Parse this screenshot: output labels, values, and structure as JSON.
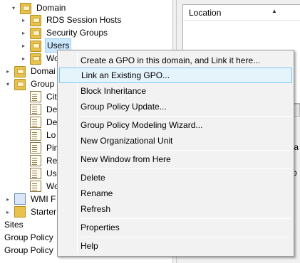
{
  "tree": {
    "items": [
      {
        "label": "Domain",
        "arrow": "▾",
        "icon": "folder-icon"
      },
      {
        "label": "RDS Session Hosts",
        "arrow": "▸",
        "icon": "folder-icon"
      },
      {
        "label": "Security Groups",
        "arrow": "▸",
        "icon": "folder-icon"
      },
      {
        "label": "Users",
        "arrow": "▸",
        "icon": "folder-icon",
        "selected": true
      },
      {
        "label": "Wo",
        "arrow": "▸",
        "icon": "folder-icon"
      },
      {
        "label": "Domai",
        "arrow": "▸",
        "icon": "folder-icon"
      },
      {
        "label": "Group",
        "arrow": "▾",
        "icon": "folder-icon"
      },
      {
        "label": "Cit",
        "icon": "gpo-document-icon"
      },
      {
        "label": "De",
        "icon": "gpo-document-icon"
      },
      {
        "label": "De",
        "icon": "gpo-document-icon"
      },
      {
        "label": "Lo",
        "icon": "gpo-document-icon"
      },
      {
        "label": "Pin",
        "icon": "gpo-document-icon"
      },
      {
        "label": "Re",
        "icon": "gpo-document-icon"
      },
      {
        "label": "Us",
        "icon": "gpo-document-icon"
      },
      {
        "label": "Wo",
        "icon": "gpo-document-icon"
      },
      {
        "label": "WMI F",
        "arrow": "▸",
        "icon": "wmi-filter-icon"
      },
      {
        "label": "Starter",
        "arrow": "▸",
        "icon": "starter-gpo-icon"
      },
      {
        "label": "Sites"
      },
      {
        "label": "Group Policy"
      },
      {
        "label": "Group Policy"
      }
    ]
  },
  "right_pane": {
    "column_header": "Location",
    "sort_indicator": "▲",
    "fragment_1": "y a",
    "fragment_2": "kb"
  },
  "context_menu": {
    "items": [
      {
        "label": "Create a GPO in this domain, and Link it here..."
      },
      {
        "label": "Link an Existing GPO...",
        "highlighted": true
      },
      {
        "label": "Block Inheritance"
      },
      {
        "label": "Group Policy Update..."
      },
      {
        "label": "Group Policy Modeling Wizard..."
      },
      {
        "label": "New Organizational Unit"
      },
      {
        "label": "New Window from Here"
      },
      {
        "label": "Delete"
      },
      {
        "label": "Rename"
      },
      {
        "label": "Refresh"
      },
      {
        "label": "Properties"
      },
      {
        "label": "Help"
      }
    ]
  }
}
